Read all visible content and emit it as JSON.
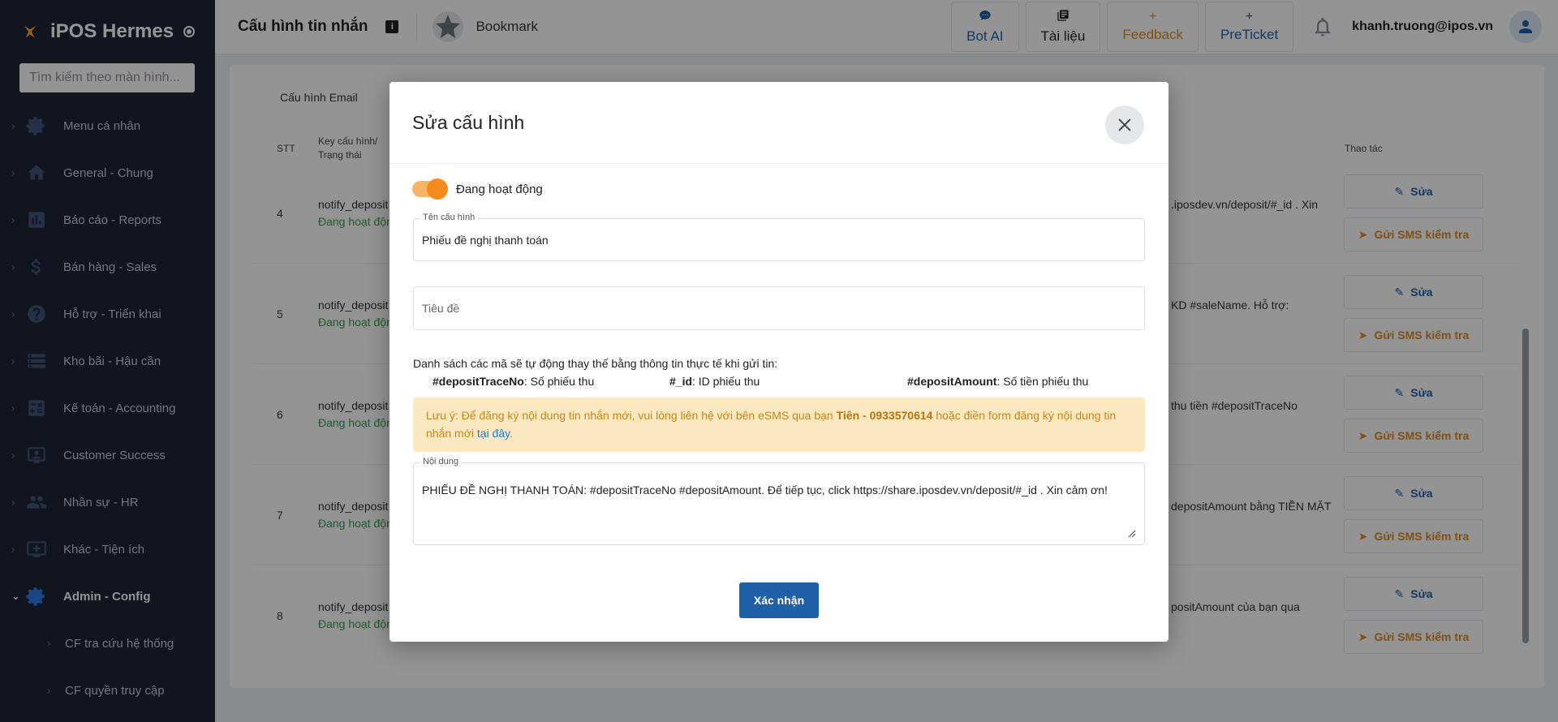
{
  "sidebar": {
    "brand": "iPOS Hermes",
    "search_placeholder": "Tìm kiếm theo màn hình...",
    "items": [
      {
        "label": "Menu cá nhân",
        "icon": "gear-icon"
      },
      {
        "label": "General - Chung",
        "icon": "home-icon"
      },
      {
        "label": "Báo cáo - Reports",
        "icon": "chart-icon"
      },
      {
        "label": "Bán hàng - Sales",
        "icon": "dollar-icon"
      },
      {
        "label": "Hỗ trợ - Triển khai",
        "icon": "help-icon"
      },
      {
        "label": "Kho bãi - Hậu cần",
        "icon": "warehouse-icon"
      },
      {
        "label": "Kế toán - Accounting",
        "icon": "accounting-icon"
      },
      {
        "label": "Customer Success",
        "icon": "customer-icon"
      },
      {
        "label": "Nhân sự - HR",
        "icon": "people-icon"
      },
      {
        "label": "Khác - Tiện ích",
        "icon": "add-box-icon"
      },
      {
        "label": "Admin - Config",
        "icon": "gear-icon",
        "active": true
      }
    ],
    "sub_items": [
      {
        "label": "CF tra cứu hệ thống"
      },
      {
        "label": "CF quyền truy cập"
      }
    ]
  },
  "topbar": {
    "title": "Cấu hình tin nhắn",
    "bookmark": "Bookmark",
    "actions": [
      {
        "label": "Bot AI",
        "icon": "chat-icon"
      },
      {
        "label": "Tài liệu",
        "icon": "document-icon"
      },
      {
        "label": "Feedback",
        "icon": "plus-icon"
      },
      {
        "label": "PreTicket",
        "icon": "plus-icon"
      }
    ],
    "user_email": "khanh.truong@ipos.vn"
  },
  "main": {
    "tab": "Cấu hình Email",
    "columns": {
      "stt": "STT",
      "key": "Key cấu hình/",
      "key2": "Trạng thái",
      "actions": "Thao tác"
    },
    "rows": [
      {
        "stt": "4",
        "key": "notify_deposit",
        "status": "Đang hoạt độn",
        "msg": ".iposdev.vn/deposit/#_id . Xin"
      },
      {
        "stt": "5",
        "key": "notify_deposit",
        "status": "Đang hoạt độn",
        "msg": "KD #saleName. Hỗ trợ:"
      },
      {
        "stt": "6",
        "key": "notify_deposit",
        "status": "Đang hoạt độn",
        "msg": "thu tiền #depositTraceNo"
      },
      {
        "stt": "7",
        "key": "notify_deposit",
        "status": "Đang hoạt độn",
        "msg": "depositAmount bằng TIỀN MẶT"
      },
      {
        "stt": "8",
        "key": "notify_deposit",
        "status": "Đang hoạt độn",
        "msg": "positAmount của bạn qua"
      }
    ],
    "edit_label": "Sửa",
    "sms_label": "Gửi SMS kiểm tra"
  },
  "modal": {
    "title": "Sửa cấu hình",
    "toggle_label": "Đang hoạt động",
    "toggle_on": true,
    "name_legend": "Tên cấu hình",
    "name_value": "Phiếu đề nghị thanh toán",
    "subject_placeholder": "Tiêu đề",
    "codes_intro": "Danh sách các mã sẽ tự động thay thế bằng thông tin thực tế khi gửi tin:",
    "codes": [
      {
        "code": "#depositTraceNo",
        "desc": ": Số phiếu thu"
      },
      {
        "code": "#_id",
        "desc": ": ID phiếu thu"
      },
      {
        "code": "#depositAmount",
        "desc": ": Số tiền phiếu thu"
      }
    ],
    "alert_prefix": "Lưu ý: Để đăng ký nội dung tin nhắn mới, vui lòng liên hệ với bên eSMS qua bạn ",
    "alert_contact": "Tiên - 0933570614",
    "alert_mid": " hoặc điền form đăng ký nội dung tin nhắn mới ",
    "alert_link": "tại đây",
    "alert_suffix": ".",
    "content_legend": "Nội dung",
    "content_value": "PHIẾU ĐỀ NGHỊ THANH TOÁN: #depositTraceNo #depositAmount. Để tiếp tục, click https://share.iposdev.vn/deposit/#_id . Xin cảm ơn!",
    "confirm_label": "Xác nhận"
  },
  "colors": {
    "sidebar_bg": "#1f2535",
    "primary": "#1e5fa8",
    "accent_orange": "#e08a1e",
    "status_green": "#2aa148",
    "alert_bg": "#fbe8c0"
  }
}
